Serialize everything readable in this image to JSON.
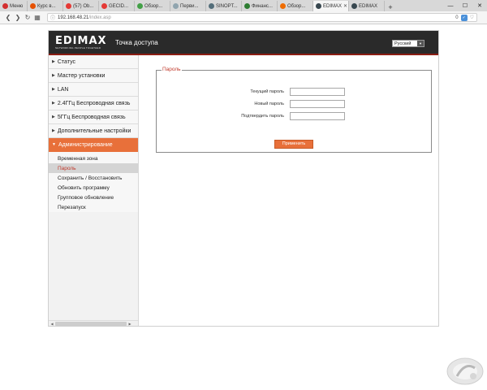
{
  "browser": {
    "tabs": [
      {
        "label": "Меню",
        "favicon_color": "#d32f2f"
      },
      {
        "label": "Курс в...",
        "favicon_color": "#e65100"
      },
      {
        "label": "(57) Ob...",
        "favicon_color": "#e53935"
      },
      {
        "label": "GECID...",
        "favicon_color": "#e53935"
      },
      {
        "label": "Обзор...",
        "favicon_color": "#43a047"
      },
      {
        "label": "Перви...",
        "favicon_color": "#90a4ae"
      },
      {
        "label": "SINOPT...",
        "favicon_color": "#546e7a"
      },
      {
        "label": "Финанс...",
        "favicon_color": "#2e7d32"
      },
      {
        "label": "Обзор...",
        "favicon_color": "#ef6c00"
      },
      {
        "label": "EDIMAX",
        "favicon_color": "#37474f"
      },
      {
        "label": "EDIMAX",
        "favicon_color": "#37474f"
      }
    ],
    "active_tab_index": 9,
    "new_tab_label": "+",
    "window_controls": [
      "—",
      "☐",
      "✕"
    ],
    "url_host": "192.168.48.21",
    "url_path": "/index.asp",
    "addr_badge": "0"
  },
  "router": {
    "logo_text": "EDIMAX",
    "logo_tagline": "NETWORKING PEOPLE TOGETHER",
    "title": "Точка доступа",
    "language": "Русский"
  },
  "sidebar": {
    "items": [
      {
        "label": "Статус"
      },
      {
        "label": "Мастер установки"
      },
      {
        "label": "LAN"
      },
      {
        "label": "2.4ГГц Беспроводная связь"
      },
      {
        "label": "5ГГц Беспроводная связь"
      },
      {
        "label": "Дополнительные настройки"
      },
      {
        "label": "Администрирование"
      }
    ],
    "active_index": 6,
    "subitems": [
      {
        "label": "Временная зона"
      },
      {
        "label": "Пароль"
      },
      {
        "label": "Сохранить / Восстановить"
      },
      {
        "label": "Обновить программу"
      },
      {
        "label": "Групповое обновление"
      },
      {
        "label": "Перезапуск"
      }
    ],
    "selected_subitem_index": 1
  },
  "password_form": {
    "legend": "Пароль",
    "current_label": "Текущий пароль",
    "new_label": "Новый пароль",
    "confirm_label": "Подтвердить пароль",
    "current_value": "",
    "new_value": "",
    "confirm_value": "",
    "apply_label": "Применить"
  },
  "colors": {
    "accent": "#e8703a",
    "header_bg": "#2a2a2a",
    "header_stripe": "#8b1d13",
    "legend_text": "#c0392b"
  }
}
